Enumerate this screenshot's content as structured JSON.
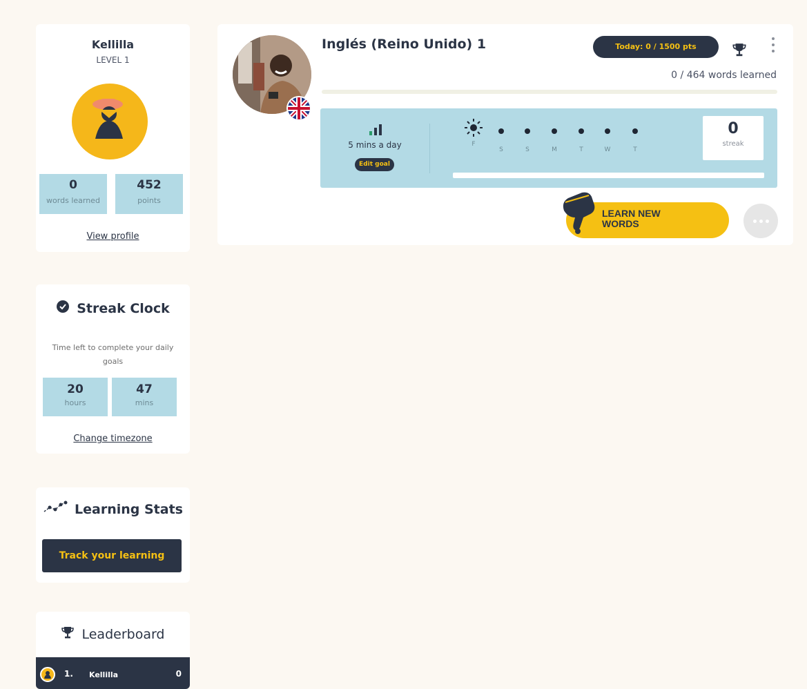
{
  "profile": {
    "username": "Kellilla",
    "level": "LEVEL 1",
    "words_learned_value": "0",
    "words_learned_label": "words learned",
    "points_value": "452",
    "points_label": "points",
    "view_profile": "View profile"
  },
  "streak_clock": {
    "title": "Streak Clock",
    "description": "Time left to complete your daily goals",
    "hours_value": "20",
    "hours_label": "hours",
    "mins_value": "47",
    "mins_label": "mins",
    "change_timezone": "Change timezone"
  },
  "learning_stats": {
    "title": "Learning Stats",
    "button": "Track your learning"
  },
  "leaderboard": {
    "title": "Leaderboard",
    "rows": [
      {
        "rank": "1.",
        "name": "Kellilla",
        "score": "0"
      }
    ]
  },
  "course": {
    "title": "Inglés (Reino Unido) 1",
    "today_pill": "Today: 0 / 1500 pts",
    "words_learned": "0 / 464 words learned",
    "progress_fraction": 0,
    "goal_text": "5 mins a day",
    "edit_goal": "Edit goal",
    "days": [
      "F",
      "S",
      "S",
      "M",
      "T",
      "W",
      "T"
    ],
    "streak_value": "0",
    "streak_label": "streak",
    "learn_button": "LEARN NEW WORDS"
  },
  "colors": {
    "accent_yellow": "#f5c013",
    "navy": "#2b3445",
    "panel_blue": "#b3dae5",
    "background": "#fcf8f2"
  },
  "icons": [
    "check-badge-icon",
    "stats-line-icon",
    "trophy-icon",
    "bars-icon",
    "sun-icon",
    "kebab-menu-icon",
    "hand-icon",
    "uk-flag-icon"
  ]
}
